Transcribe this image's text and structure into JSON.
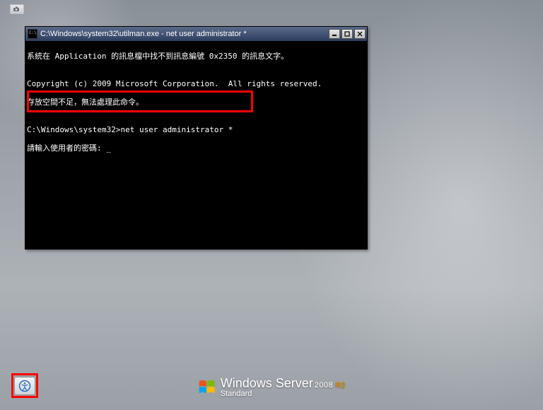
{
  "desktop": {
    "top_mini_icon": "camera-icon"
  },
  "console": {
    "title": "C:\\Windows\\system32\\utilman.exe - net  user administrator *",
    "lines": {
      "l0": "系統在 Application 的訊息檔中找不到訊息編號 0x2350 的訊息文字。",
      "l1": "",
      "l2": "Copyright (c) 2009 Microsoft Corporation.  All rights reserved.",
      "l3": "存放空間不足，無法處理此命令。",
      "l4": "",
      "l5": "C:\\Windows\\system32>net user administrator *",
      "l6": "請輸入使用者的密碼: _"
    }
  },
  "brand": {
    "product": "Windows Server",
    "year": "2008",
    "variant": "R2",
    "edition": "Standard"
  },
  "ease_of_access": {
    "label": "Ease of Access"
  }
}
